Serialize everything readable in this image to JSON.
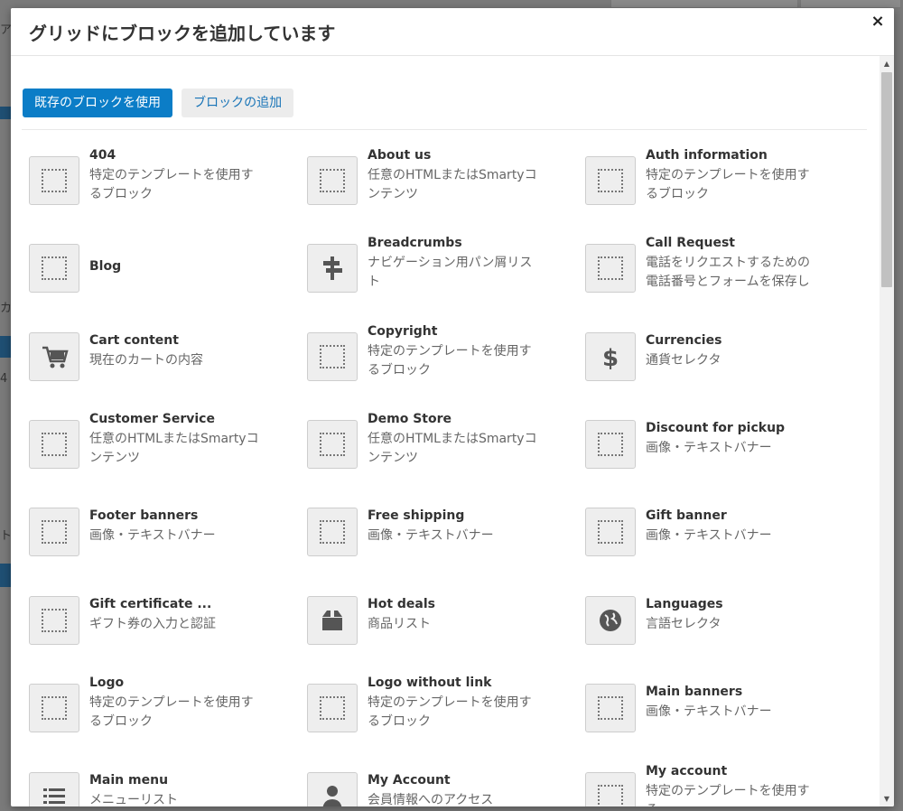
{
  "background": {
    "fragments": [
      "ア",
      "カ",
      "4",
      "ト"
    ]
  },
  "modal": {
    "title": "グリッドにブロックを追加しています",
    "close_label": "×",
    "tabs": [
      {
        "label": "既存のブロックを使用",
        "active": true
      },
      {
        "label": "ブロックの追加",
        "active": false
      }
    ]
  },
  "blocks": [
    {
      "name": "404",
      "desc": "特定のテンプレートを使用するブロック",
      "icon": "placeholder-icon"
    },
    {
      "name": "About us",
      "desc": "任意のHTMLまたはSmartyコンテンツ",
      "icon": "placeholder-icon"
    },
    {
      "name": "Auth information",
      "desc": "特定のテンプレートを使用するブロック",
      "icon": "placeholder-icon"
    },
    {
      "name": "Blog",
      "desc": "",
      "icon": "placeholder-icon"
    },
    {
      "name": "Breadcrumbs",
      "desc": "ナビゲーション用パン屑リスト",
      "icon": "signpost-icon"
    },
    {
      "name": "Call Request",
      "desc": "電話をリクエストするための電話番号とフォームを保存し",
      "icon": "placeholder-icon"
    },
    {
      "name": "Cart content",
      "desc": "現在のカートの内容",
      "icon": "cart-icon"
    },
    {
      "name": "Copyright",
      "desc": "特定のテンプレートを使用するブロック",
      "icon": "placeholder-icon"
    },
    {
      "name": "Currencies",
      "desc": "通貨セレクタ",
      "icon": "dollar-icon"
    },
    {
      "name": "Customer Service",
      "desc": "任意のHTMLまたはSmartyコンテンツ",
      "icon": "placeholder-icon"
    },
    {
      "name": "Demo Store",
      "desc": "任意のHTMLまたはSmartyコンテンツ",
      "icon": "placeholder-icon"
    },
    {
      "name": "Discount for pickup",
      "desc": "画像・テキストバナー",
      "icon": "placeholder-icon"
    },
    {
      "name": "Footer banners",
      "desc": "画像・テキストバナー",
      "icon": "placeholder-icon"
    },
    {
      "name": "Free shipping",
      "desc": "画像・テキストバナー",
      "icon": "placeholder-icon"
    },
    {
      "name": "Gift banner",
      "desc": "画像・テキストバナー",
      "icon": "placeholder-icon"
    },
    {
      "name": "Gift certificate ...",
      "desc": "ギフト券の入力と認証",
      "icon": "placeholder-icon"
    },
    {
      "name": "Hot deals",
      "desc": "商品リスト",
      "icon": "box-icon"
    },
    {
      "name": "Languages",
      "desc": "言語セレクタ",
      "icon": "globe-icon"
    },
    {
      "name": "Logo",
      "desc": "特定のテンプレートを使用するブロック",
      "icon": "placeholder-icon"
    },
    {
      "name": "Logo without link",
      "desc": "特定のテンプレートを使用するブロック",
      "icon": "placeholder-icon"
    },
    {
      "name": "Main banners",
      "desc": "画像・テキストバナー",
      "icon": "placeholder-icon"
    },
    {
      "name": "Main menu",
      "desc": "メニューリスト",
      "icon": "list-icon"
    },
    {
      "name": "My Account",
      "desc": "会員情報へのアクセス",
      "icon": "user-icon"
    },
    {
      "name": "My account",
      "desc": "特定のテンプレートを使用する",
      "icon": "placeholder-icon"
    }
  ]
}
